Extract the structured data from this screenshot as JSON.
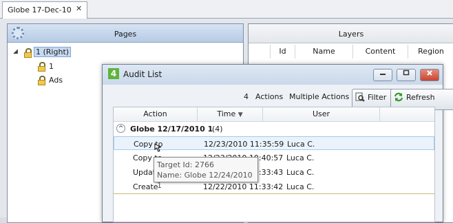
{
  "doc_tab": {
    "title": "Globe 17-Dec-10",
    "close_glyph": "✕"
  },
  "pages_panel": {
    "title": "Pages",
    "tree": [
      {
        "label": "1  (Right)",
        "expander": "◢",
        "selected": true
      },
      {
        "label": "1"
      },
      {
        "label": "Ads"
      }
    ]
  },
  "layers_panel": {
    "title": "Layers",
    "columns": [
      "Id",
      "Name",
      "Content",
      "Region"
    ]
  },
  "audit_dialog": {
    "title": "Audit List",
    "app_icon": "4",
    "toolbar": {
      "count": "4",
      "actions_label": "Actions",
      "scope_label": "Multiple Actions",
      "filter_label": "Filter",
      "refresh_label": "Refresh"
    },
    "columns": {
      "action": "Action",
      "time": "Time",
      "user": "User",
      "sort_glyph": "▼"
    },
    "group": {
      "collapse_glyph": "^",
      "name": "Globe 12/17/2010 1",
      "count": "(4)"
    },
    "rows": [
      {
        "action": "Copy to",
        "time": "12/23/2010 11:35:59",
        "user": "Luca C."
      },
      {
        "action": "Copy to",
        "time": "12/23/2010 10:40:57",
        "user": "Luca C."
      },
      {
        "action": "Update",
        "time": "12/23/2010 10:33:43",
        "user": "Luca C."
      },
      {
        "action": "Create",
        "time": "12/22/2010 11:33:42",
        "user": "Luca C."
      }
    ],
    "selected_row": 0
  },
  "tooltip": {
    "line1": "Target Id: 2766",
    "line2": "Name: Globe 12/24/2010 1"
  },
  "colors": {
    "header_blue": "#b6cbe4",
    "selection": "#c7daf1",
    "refresh_green": "#3b9a2e",
    "app_icon_green": "#5eb43d"
  }
}
